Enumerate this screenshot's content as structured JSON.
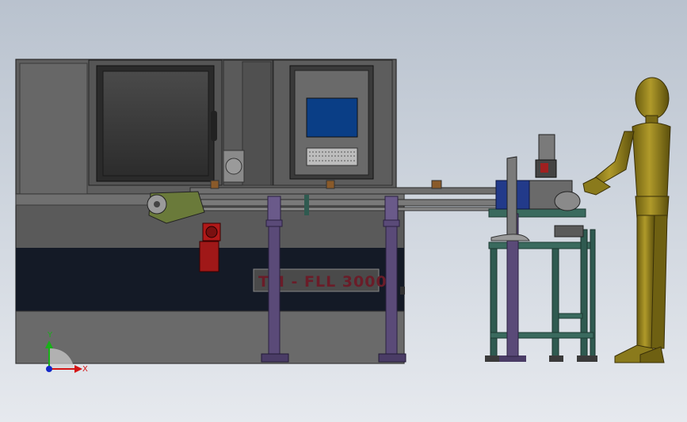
{
  "scene": {
    "machine_label": "TM - FLL 3000",
    "triad": {
      "x_label": "X",
      "y_label": "Y"
    }
  },
  "colors": {
    "background_top": "#b9c2ce",
    "background_bottom": "#e6e9ee",
    "machine_body": "#5c5c5c",
    "machine_dark_band": "#141a26",
    "screen_blue": "#0a3e86",
    "conveyor_support": "#5a4a78",
    "workstation_frame": "#2f5a50",
    "mannequin_gold": "#8a7a1c",
    "motor_red": "#b01818",
    "triad_x": "#d41414",
    "triad_y": "#18b018",
    "triad_z": "#1428c8"
  }
}
